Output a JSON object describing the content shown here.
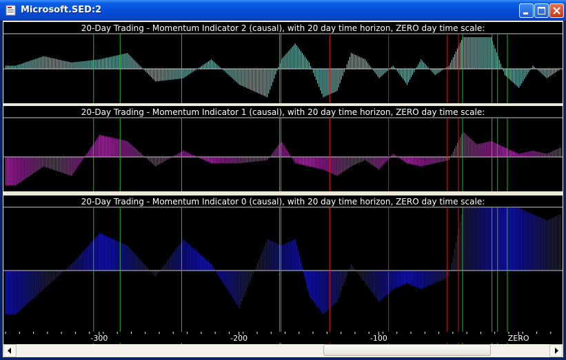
{
  "window": {
    "title": "Microsoft.SED:2"
  },
  "title_buttons": {
    "minimize": "minimize",
    "maximize": "maximize",
    "close": "close"
  },
  "colors": {
    "background": "#000000",
    "axis_line": "#c8c8c8",
    "green_marker": "#20c020",
    "red_marker": "#d01818",
    "series_indicator_2": "#7fc8c0",
    "series_indicator_1": "#b030b0",
    "series_indicator_0": "#1a1aa8"
  },
  "chart_data": [
    {
      "type": "bar",
      "title": "20-Day Trading - Momentum Indicator 2 (causal), with 20 day time horizon, ZERO day time scale:",
      "color": "#7fc8c0",
      "x": [
        -360,
        -340,
        -320,
        -300,
        -280,
        -260,
        -240,
        -220,
        -200,
        -180,
        -170,
        -160,
        -150,
        -140,
        -130,
        -120,
        -110,
        -100,
        -90,
        -80,
        -70,
        -60,
        -50,
        -40,
        -30,
        -20,
        -10,
        0,
        10,
        20,
        30
      ],
      "y": [
        0.1,
        0.4,
        0.2,
        0.3,
        0.5,
        -0.4,
        -0.3,
        0.3,
        -0.5,
        -0.9,
        0.3,
        0.8,
        0.2,
        -0.9,
        -0.7,
        0.5,
        0.3,
        -0.3,
        0.1,
        -0.5,
        0.3,
        -0.2,
        0.1,
        1.0,
        1.0,
        1.0,
        -0.2,
        -0.6,
        0.1,
        -0.3,
        0.0
      ],
      "ylim": [
        -1,
        1
      ],
      "xlim": [
        -367,
        30
      ]
    },
    {
      "type": "bar",
      "title": "20-Day Trading - Momentum Indicator 1 (causal), with 20 day time horizon, ZERO day time scale:",
      "color": "#b030b0",
      "x": [
        -360,
        -340,
        -320,
        -300,
        -280,
        -260,
        -240,
        -220,
        -200,
        -180,
        -170,
        -160,
        -150,
        -140,
        -130,
        -120,
        -110,
        -100,
        -90,
        -80,
        -70,
        -60,
        -50,
        -40,
        -30,
        -20,
        -10,
        0,
        10,
        20,
        30
      ],
      "y": [
        -0.9,
        -0.3,
        -0.6,
        0.7,
        0.5,
        -0.3,
        0.2,
        -0.2,
        -0.2,
        -0.1,
        0.5,
        -0.2,
        -0.3,
        -0.4,
        -0.6,
        -0.3,
        -0.1,
        -0.4,
        0.1,
        -0.2,
        -0.3,
        -0.2,
        -0.1,
        0.8,
        0.4,
        0.5,
        0.3,
        0.1,
        0.2,
        0.1,
        0.3
      ],
      "ylim": [
        -1,
        1
      ],
      "xlim": [
        -367,
        30
      ]
    },
    {
      "type": "bar",
      "title": "20-Day Trading - Momentum Indicator 0 (causal), with 20 day time horizon, ZERO day time scale:",
      "color": "#1a1aa8",
      "x": [
        -360,
        -340,
        -320,
        -300,
        -280,
        -260,
        -240,
        -220,
        -200,
        -180,
        -170,
        -160,
        -150,
        -140,
        -130,
        -120,
        -110,
        -100,
        -90,
        -80,
        -70,
        -60,
        -50,
        -40,
        -30,
        -20,
        -10,
        0,
        10,
        20,
        30
      ],
      "y": [
        -0.7,
        -0.3,
        0.1,
        0.6,
        0.4,
        -0.1,
        0.5,
        0.1,
        -0.6,
        0.5,
        0.4,
        0.5,
        -0.4,
        -0.7,
        -0.5,
        0.1,
        -0.2,
        -0.5,
        -0.3,
        -0.2,
        -0.3,
        -0.2,
        -0.1,
        1.0,
        1.0,
        1.0,
        1.0,
        1.0,
        0.9,
        0.8,
        0.9
      ],
      "ylim": [
        -1,
        1
      ],
      "xlim": [
        -367,
        30
      ]
    }
  ],
  "markers": {
    "green_x": [
      -304,
      -285,
      -241,
      -170,
      -171,
      -40,
      -19,
      -15,
      -8
    ],
    "red_x": [
      -135,
      -93,
      -51,
      -43
    ]
  },
  "x_axis": {
    "ticks": [
      -300,
      -200,
      -100,
      0
    ],
    "tick_labels": [
      "-300",
      "-200",
      "-100",
      "ZERO"
    ]
  },
  "scrollbar": {
    "left_arrow": "◄",
    "right_arrow": "►"
  }
}
